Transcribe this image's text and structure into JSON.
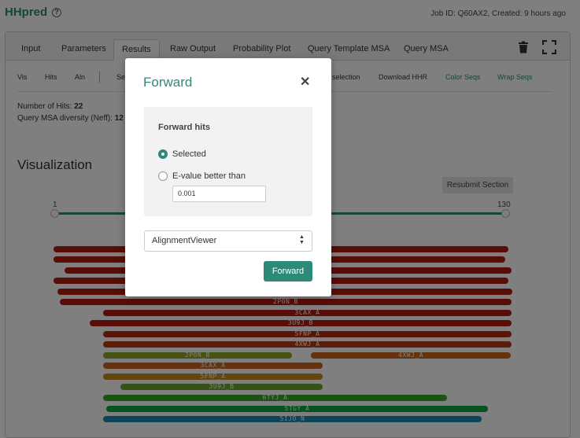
{
  "app": {
    "title": "HHpred",
    "help_icon": "question-circle-icon",
    "job_info": "Job ID: Q60AX2,  Created: 9 hours ago"
  },
  "tabs": [
    {
      "label": "Input"
    },
    {
      "label": "Parameters"
    },
    {
      "label": "Results"
    },
    {
      "label": "Raw Output"
    },
    {
      "label": "Probability Plot"
    },
    {
      "label": "Query Template MSA"
    },
    {
      "label": "Query MSA"
    }
  ],
  "toolbar": {
    "trash_icon": "trash-icon",
    "fullscreen_icon": "expand-icon"
  },
  "subtabs": {
    "vis": "Vis",
    "hits": "Hits",
    "aln": "Aln",
    "sel_partial": "Sel",
    "selection_partial": "selection",
    "download_hhr": "Download HHR",
    "color_seqs": "Color Seqs",
    "wrap_seqs": "Wrap Seqs"
  },
  "info": {
    "hits_label": "Number of Hits:",
    "hits_value": "22",
    "diversity_label": "Query MSA diversity (Neff):",
    "diversity_value": "12"
  },
  "visualization": {
    "title": "Visualization",
    "resubmit": "Resubmit Section",
    "slider_min": "1",
    "slider_max": "130"
  },
  "hits": [
    {
      "label": "",
      "color": "#b01a10"
    },
    {
      "label": "",
      "color": "#b01a10"
    },
    {
      "label": "",
      "color": "#b01a10"
    },
    {
      "label": "",
      "color": "#b01a10"
    },
    {
      "label": "",
      "color": "#b01a10"
    },
    {
      "label": "2P0N_B",
      "color": "#b01a10"
    },
    {
      "label": "3CAX_A",
      "color": "#b01a10"
    },
    {
      "label": "3U9J_B",
      "color": "#b01a10"
    },
    {
      "label": "5FNP_A",
      "color": "#b42a12"
    },
    {
      "label": "4XWJ_A",
      "color": "#b83a14"
    },
    {
      "label": "2P0N_B",
      "color": "#8aa528"
    },
    {
      "label": "4XWJ_A",
      "color": "#c8641a"
    },
    {
      "label": "3CAX_A",
      "color": "#c8641a"
    },
    {
      "label": "5FNP_A",
      "color": "#c48a1e"
    },
    {
      "label": "3U9J_B",
      "color": "#6aa52e"
    },
    {
      "label": "6TYJ_A",
      "color": "#3aa52a"
    },
    {
      "label": "5TGY_A",
      "color": "#0aa53e"
    },
    {
      "label": "5IJO_N",
      "color": "#1a8ab0"
    }
  ],
  "modal": {
    "title": "Forward",
    "close_icon": "close-icon",
    "section_title": "Forward hits",
    "option_selected": "Selected",
    "option_evalue": "E-value better than",
    "evalue_value": "0.001",
    "target_select": "AlignmentViewer",
    "forward_button": "Forward"
  }
}
